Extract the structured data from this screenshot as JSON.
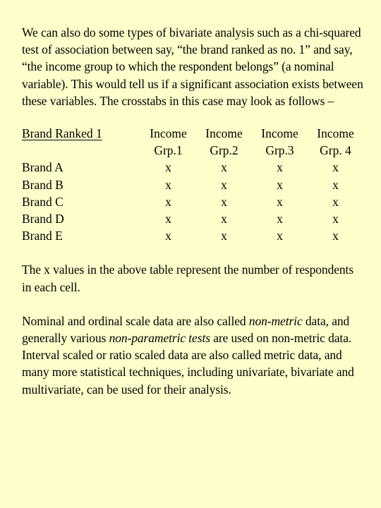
{
  "slide": {
    "background_color": "#FFFFCC",
    "text_color": "#000000",
    "intro_paragraph": "We can also do some types of bivariate analysis such as a chi-squared test of association between say, “the brand ranked as no. 1” and say, “the income group to which the respondent belongs” (a nominal variable). This would tell us if a significant association exists between these variables. The crosstabs in this case may look as follows –",
    "table": {
      "row_header_label": "Brand Ranked 1",
      "column_headers": [
        {
          "line1": "Income",
          "line2": "Grp.1"
        },
        {
          "line1": "Income",
          "line2": "Grp.2"
        },
        {
          "line1": "Income",
          "line2": "Grp.3"
        },
        {
          "line1": "Income",
          "line2": "Grp. 4"
        }
      ],
      "rows": [
        {
          "label": "Brand A",
          "cells": [
            "x",
            "x",
            "x",
            "x"
          ]
        },
        {
          "label": "Brand B",
          "cells": [
            "x",
            "x",
            "x",
            "x"
          ]
        },
        {
          "label": "Brand C",
          "cells": [
            "x",
            "x",
            "x",
            "x"
          ]
        },
        {
          "label": "Brand D",
          "cells": [
            "x",
            "x",
            "x",
            "x"
          ]
        },
        {
          "label": "Brand E",
          "cells": [
            "x",
            "x",
            "x",
            "x"
          ]
        }
      ]
    },
    "note_paragraph": "The x values in the above table represent the number of respondents in each cell.",
    "closing_paragraph": {
      "part1": "Nominal and ordinal scale data are also called ",
      "em1": "non-metric",
      "part2": " data, and generally various ",
      "em2": "non-parametric tests",
      "part3": " are used on non-metric data. Interval scaled or ratio scaled data are also called metric data, and many more statistical techniques, including univariate, bivariate and multivariate, can be used for their analysis."
    }
  }
}
